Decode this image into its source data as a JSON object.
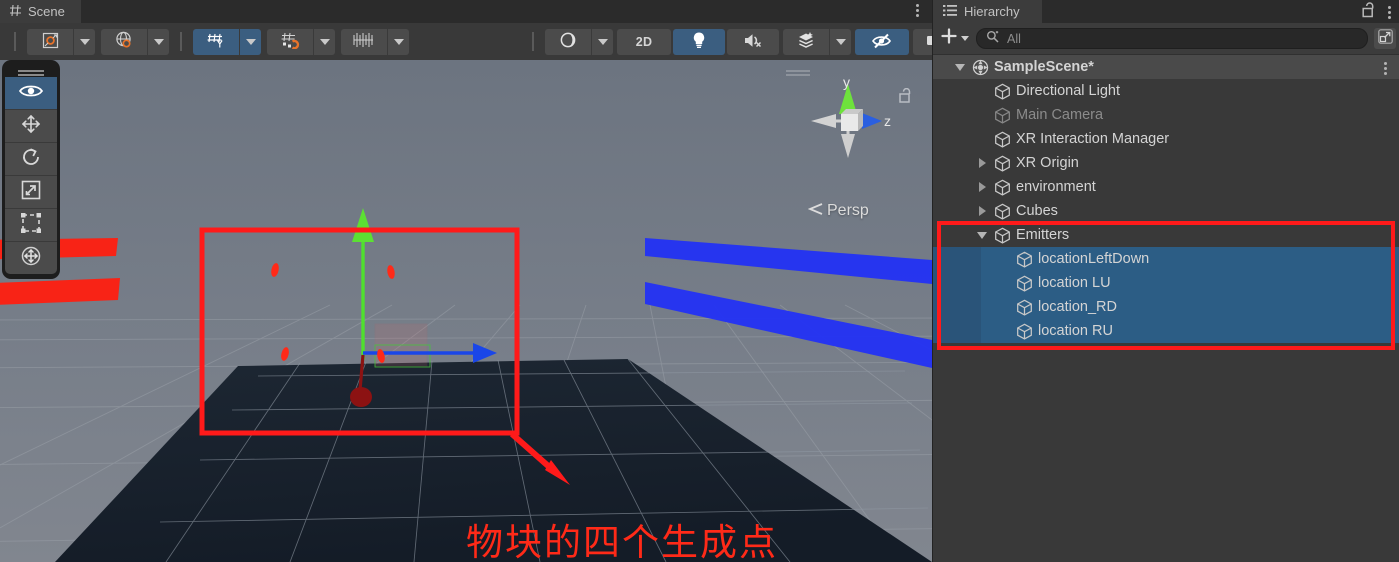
{
  "scene_panel": {
    "tab": {
      "label": "Scene",
      "icon": "grid-icon"
    },
    "toolbar": {
      "pivot_button": {
        "icon": "pivot-center-icon",
        "active": false
      },
      "handle_space_button": {
        "icon": "global-local-icon",
        "active": false
      },
      "grid_axis_button": {
        "icon": "grid-y-axis-icon",
        "active": true
      },
      "grid_snap_button": {
        "icon": "grid-snap-magnet-icon",
        "active": false
      },
      "snap_increment_button": {
        "icon": "snap-increment-icon",
        "active": false
      },
      "shading_button": {
        "icon": "shading-mode-icon",
        "active": false
      },
      "view2d_button": {
        "label": "2D",
        "active": false
      },
      "lighting_button": {
        "icon": "light-bulb-icon",
        "active": true
      },
      "audio_button": {
        "icon": "audio-mute-icon",
        "active": false
      },
      "effects_button": {
        "icon": "fx-layers-icon",
        "active": false
      },
      "visibility_button": {
        "icon": "eye-hidden-icon",
        "active": true
      },
      "camera_button": {
        "icon": "scene-camera-icon",
        "active": false
      },
      "gizmos_button": {
        "icon": "gizmos-globe-icon",
        "active": true
      }
    },
    "tool_palette": [
      {
        "name": "view-tool",
        "icon": "eye-icon",
        "active": true
      },
      {
        "name": "move-tool",
        "icon": "move-arrows-icon",
        "active": false
      },
      {
        "name": "rotate-tool",
        "icon": "rotate-icon",
        "active": false
      },
      {
        "name": "scale-tool",
        "icon": "scale-icon",
        "active": false
      },
      {
        "name": "rect-tool",
        "icon": "rect-transform-icon",
        "active": false
      },
      {
        "name": "transform-tool",
        "icon": "transform-icon",
        "active": false
      }
    ],
    "gizmo": {
      "y_axis_label": "y",
      "z_axis_label": "z",
      "projection_label": "Persp",
      "lock_icon": "lock-open-icon"
    },
    "annotation": {
      "text": "物块的四个生成点",
      "color": "#ff2a18"
    }
  },
  "hierarchy_panel": {
    "tab": {
      "label": "Hierarchy",
      "icon": "hierarchy-list-icon"
    },
    "lock_icon": "lock-open-icon",
    "menu_icon": "kebab-menu-icon",
    "toolbar": {
      "create_label": "+",
      "search_placeholder": "All",
      "search_value": "",
      "search_icon": "search-icon",
      "popout_icon": "open-in-new-window-icon"
    },
    "tree": [
      {
        "name": "SampleScene*",
        "depth": 0,
        "twisty": "down",
        "icon": "unity-scene-icon",
        "state": "scene-root",
        "kebab": true
      },
      {
        "name": "Directional Light",
        "depth": 1,
        "twisty": "none",
        "icon": "gameobject-cube-icon",
        "state": "normal"
      },
      {
        "name": "Main Camera",
        "depth": 1,
        "twisty": "none",
        "icon": "gameobject-cube-icon",
        "state": "dim"
      },
      {
        "name": "XR Interaction Manager",
        "depth": 1,
        "twisty": "none",
        "icon": "gameobject-cube-icon",
        "state": "normal"
      },
      {
        "name": "XR Origin",
        "depth": 1,
        "twisty": "right",
        "icon": "gameobject-cube-icon",
        "state": "normal"
      },
      {
        "name": "environment",
        "depth": 1,
        "twisty": "right",
        "icon": "gameobject-cube-icon",
        "state": "normal"
      },
      {
        "name": "Cubes",
        "depth": 1,
        "twisty": "right",
        "icon": "gameobject-cube-icon",
        "state": "normal"
      },
      {
        "name": "Emitters",
        "depth": 1,
        "twisty": "down",
        "icon": "gameobject-cube-icon",
        "state": "normal"
      },
      {
        "name": "locationLeftDown",
        "depth": 2,
        "twisty": "none",
        "icon": "gameobject-cube-icon",
        "state": "selected"
      },
      {
        "name": "location LU",
        "depth": 2,
        "twisty": "none",
        "icon": "gameobject-cube-icon",
        "state": "selected"
      },
      {
        "name": "location_RD",
        "depth": 2,
        "twisty": "none",
        "icon": "gameobject-cube-icon",
        "state": "selected"
      },
      {
        "name": "location RU",
        "depth": 2,
        "twisty": "none",
        "icon": "gameobject-cube-icon",
        "state": "selected"
      }
    ],
    "highlight_box_color": "#ff1a1a"
  },
  "colors": {
    "panel_bg": "#393939",
    "tab_bg": "#3c3c3c",
    "tabbar_bg": "#2b2b2b",
    "selection_blue": "#2c5d85",
    "accent_blue": "#3b5e80",
    "annotation_red": "#ff1a1a",
    "axis_green": "#5ce033",
    "axis_blue": "#1a46e8",
    "axis_red": "#8c1212"
  }
}
